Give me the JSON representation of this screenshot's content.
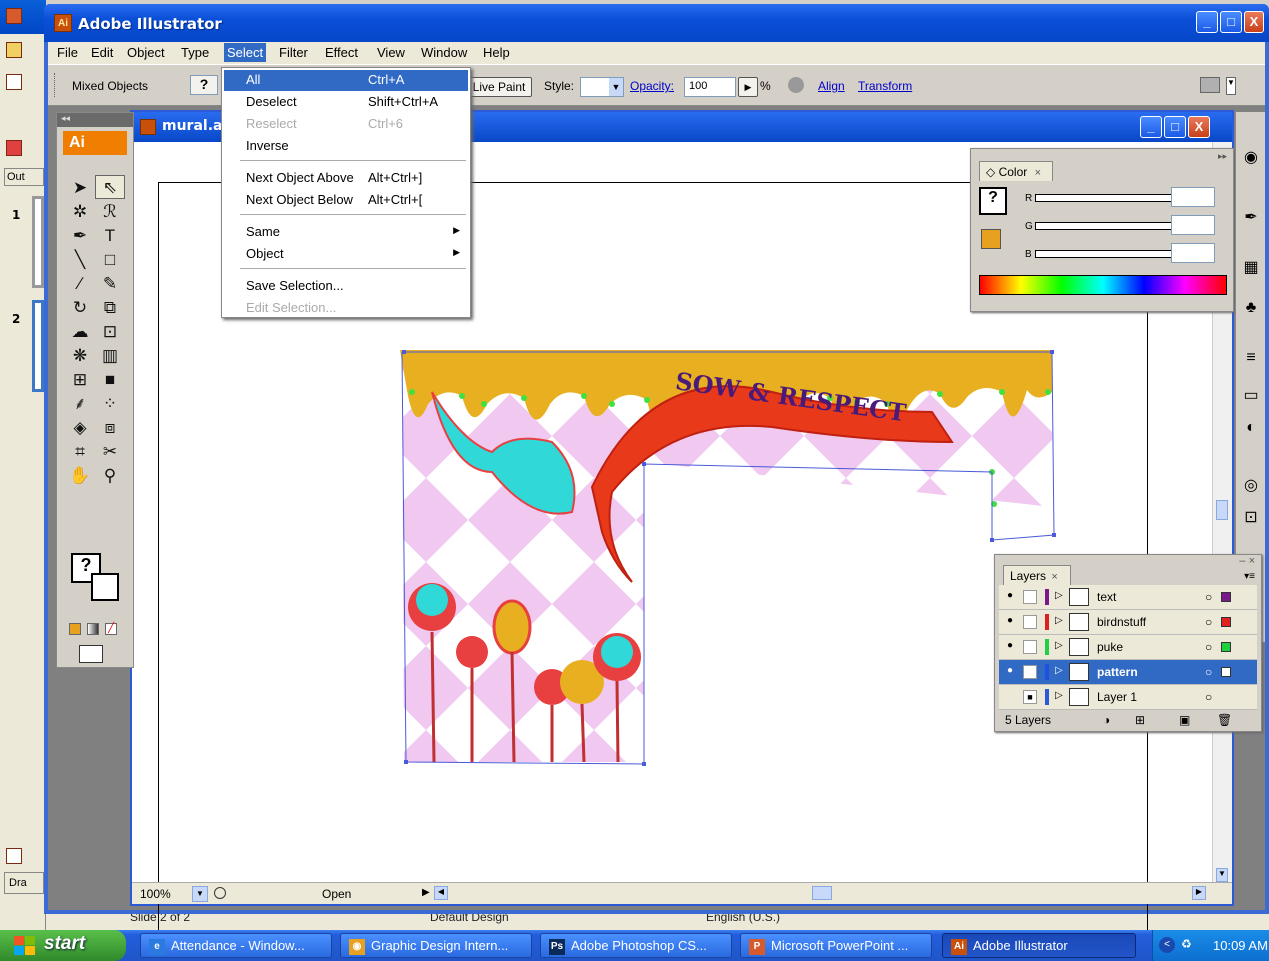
{
  "powerpoint": {
    "slide_numbers": [
      "1",
      "2"
    ],
    "side_tab": "Out",
    "bottom_tab": "Dra",
    "status": [
      "Slide 2 of 2",
      "Default Design",
      "English (U.S.)"
    ]
  },
  "window": {
    "title": "Adobe Illustrator",
    "app_badge": "Ai",
    "buttons": [
      "_",
      "□",
      "X"
    ]
  },
  "menubar": {
    "items": [
      "File",
      "Edit",
      "Object",
      "Type",
      "Select",
      "Filter",
      "Effect",
      "View",
      "Window",
      "Help"
    ],
    "active": "Select"
  },
  "controlbar": {
    "selection_type": "Mixed Objects",
    "live_paint": "Live Paint",
    "style_label": "Style:",
    "opacity_label": "Opacity:",
    "opacity_value": "100",
    "percent": "%",
    "align": "Align",
    "transform": "Transform"
  },
  "document": {
    "title": "mural.a",
    "zoom": "100%",
    "status": "Open"
  },
  "tools": {
    "logo": "Ai",
    "icons": [
      "selection-tool",
      "direct-selection-tool",
      "magic-wand-tool",
      "lasso-tool",
      "pen-tool",
      "type-tool",
      "line-tool",
      "rectangle-tool",
      "paintbrush-tool",
      "pencil-tool",
      "rotate-tool",
      "scale-tool",
      "warp-tool",
      "free-transform-tool",
      "symbol-sprayer-tool",
      "graph-tool",
      "mesh-tool",
      "gradient-tool",
      "eyedropper-tool",
      "blend-tool",
      "live-paint-bucket-tool",
      "live-paint-selection-tool",
      "slice-tool",
      "scissors-tool",
      "hand-tool",
      "zoom-tool"
    ]
  },
  "select_menu": {
    "items": [
      {
        "label": "All",
        "shortcut": "Ctrl+A",
        "state": "highlight"
      },
      {
        "label": "Deselect",
        "shortcut": "Shift+Ctrl+A",
        "state": "normal"
      },
      {
        "label": "Reselect",
        "shortcut": "Ctrl+6",
        "state": "disabled"
      },
      {
        "label": "Inverse",
        "shortcut": "",
        "state": "normal"
      },
      {
        "label": "Next Object Above",
        "shortcut": "Alt+Ctrl+]",
        "state": "normal"
      },
      {
        "label": "Next Object Below",
        "shortcut": "Alt+Ctrl+[",
        "state": "normal"
      },
      {
        "label": "Same",
        "shortcut": "",
        "state": "submenu"
      },
      {
        "label": "Object",
        "shortcut": "",
        "state": "submenu"
      },
      {
        "label": "Save Selection...",
        "shortcut": "",
        "state": "normal"
      },
      {
        "label": "Edit Selection...",
        "shortcut": "",
        "state": "disabled"
      }
    ]
  },
  "color_panel": {
    "tab": "◇ Color",
    "channels": [
      "R",
      "G",
      "B"
    ],
    "fill_icon": "?"
  },
  "layers_panel": {
    "tab": "Layers",
    "layers": [
      {
        "name": "text",
        "color": "#7a1a8a",
        "selected": false,
        "locked": false
      },
      {
        "name": "birdnstuff",
        "color": "#e02020",
        "selected": false,
        "locked": false
      },
      {
        "name": "puke",
        "color": "#20d040",
        "selected": false,
        "locked": false
      },
      {
        "name": "pattern",
        "color": "#2050e0",
        "selected": true,
        "locked": false
      },
      {
        "name": "Layer 1",
        "color": "#2a5ad8",
        "selected": false,
        "locked": true
      }
    ],
    "count": "5 Layers"
  },
  "artwork": {
    "banner_text": "SOW & RESPECT",
    "colors": {
      "drip": "#e8b020",
      "pattern": "#f0c8f0",
      "bird": "#30d8d8",
      "banner": "#e83a1a",
      "path": "#e84040",
      "anchor_green": "#40e040",
      "bounding": "#4a5ad8"
    }
  },
  "taskbar": {
    "start": "start",
    "tasks": [
      {
        "label": "Attendance - Window...",
        "icon": "ie-icon",
        "active": false
      },
      {
        "label": "Graphic Design Intern...",
        "icon": "chrome-icon",
        "active": false
      },
      {
        "label": "Adobe Photoshop CS...",
        "icon": "photoshop-icon",
        "active": false
      },
      {
        "label": "Microsoft PowerPoint ...",
        "icon": "powerpoint-icon",
        "active": false
      },
      {
        "label": "Adobe Illustrator",
        "icon": "illustrator-icon",
        "active": true
      }
    ],
    "clock": "10:09 AM"
  }
}
